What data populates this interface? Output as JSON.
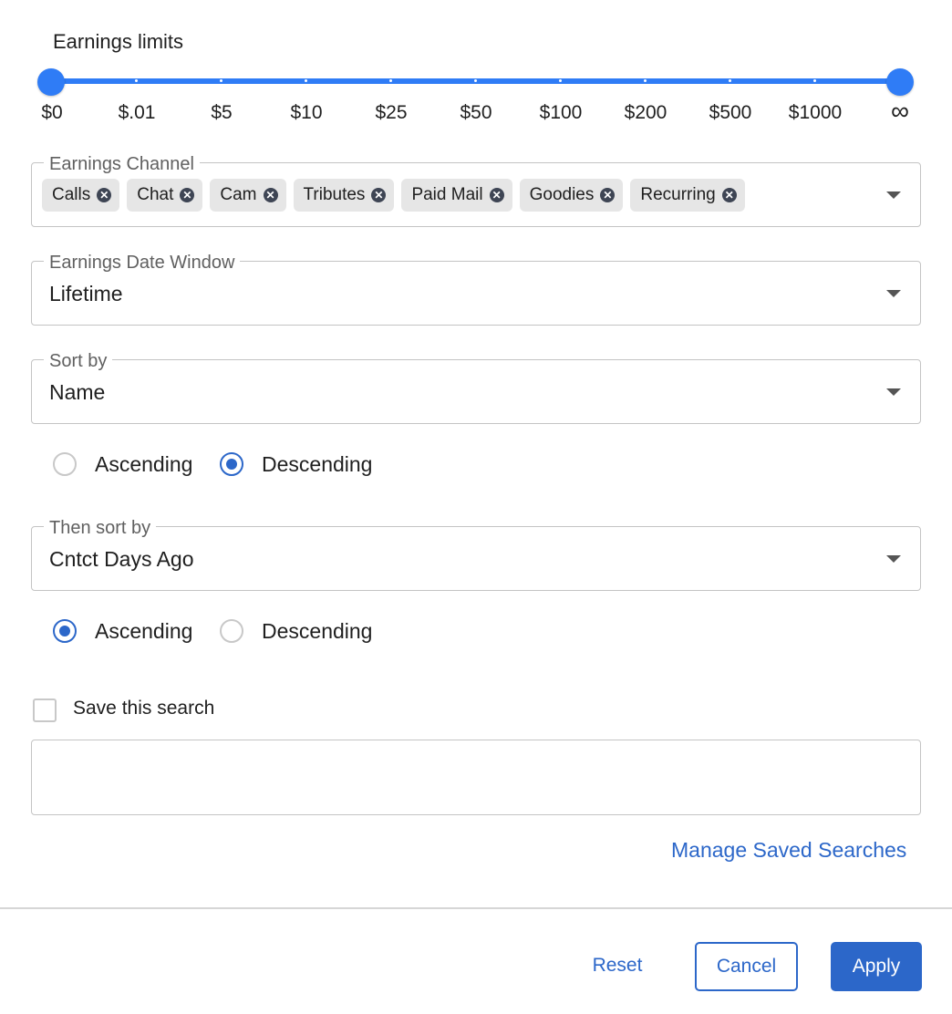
{
  "earnings_limits": {
    "title": "Earnings limits",
    "marks": [
      "$0",
      "$.01",
      "$5",
      "$10",
      "$25",
      "$50",
      "$100",
      "$200",
      "$500",
      "$1000",
      "∞"
    ],
    "range_selected": [
      "$0",
      "∞"
    ],
    "accent_color": "#2f7cf6"
  },
  "earnings_channel": {
    "label": "Earnings Channel",
    "chips": [
      "Calls",
      "Chat",
      "Cam",
      "Tributes",
      "Paid Mail",
      "Goodies",
      "Recurring"
    ],
    "remove_icon": "close-circle-icon"
  },
  "date_window": {
    "label": "Earnings Date Window",
    "value": "Lifetime"
  },
  "sort_by": {
    "label": "Sort by",
    "value": "Name",
    "ascending_label": "Ascending",
    "descending_label": "Descending",
    "selected": "Descending"
  },
  "then_sort_by": {
    "label": "Then sort by",
    "value": "Cntct Days Ago",
    "ascending_label": "Ascending",
    "descending_label": "Descending",
    "selected": "Ascending"
  },
  "save_search": {
    "label": "Save this search",
    "checked": false,
    "input_value": ""
  },
  "manage_link": "Manage Saved Searches",
  "footer": {
    "reset": "Reset",
    "cancel": "Cancel",
    "apply": "Apply"
  },
  "colors": {
    "primary": "#2c67c9",
    "slider": "#2f7cf6"
  }
}
